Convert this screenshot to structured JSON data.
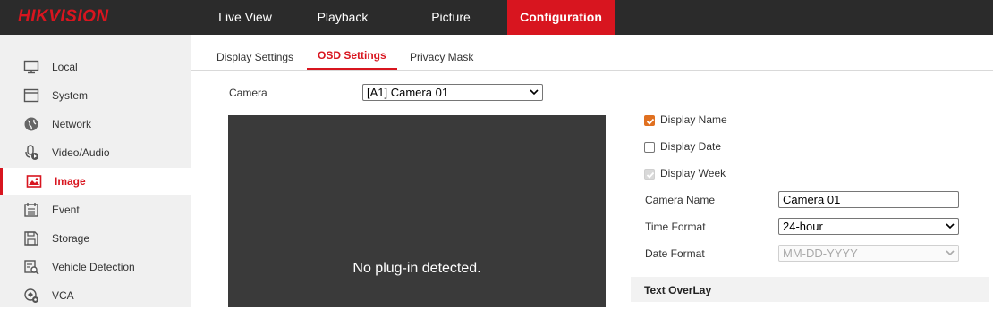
{
  "brand": "HIKVISION",
  "nav": {
    "tabs": [
      "Live View",
      "Playback",
      "Picture",
      "Configuration"
    ],
    "active": "Configuration"
  },
  "sidebar": {
    "items": [
      {
        "label": "Local",
        "icon": "monitor-icon"
      },
      {
        "label": "System",
        "icon": "system-window-icon"
      },
      {
        "label": "Network",
        "icon": "globe-icon"
      },
      {
        "label": "Video/Audio",
        "icon": "microphone-icon"
      },
      {
        "label": "Image",
        "icon": "image-icon"
      },
      {
        "label": "Event",
        "icon": "calendar-icon"
      },
      {
        "label": "Storage",
        "icon": "floppy-disk-icon"
      },
      {
        "label": "Vehicle Detection",
        "icon": "vehicle-search-icon"
      },
      {
        "label": "VCA",
        "icon": "vca-settings-icon"
      }
    ],
    "active": "Image"
  },
  "subtabs": {
    "items": [
      "Display Settings",
      "OSD Settings",
      "Privacy Mask"
    ],
    "active": "OSD Settings"
  },
  "form": {
    "camera_label": "Camera",
    "camera_value": "[A1] Camera 01",
    "display_name_label": "Display Name",
    "display_name_checked": true,
    "display_date_label": "Display Date",
    "display_date_checked": false,
    "display_week_label": "Display Week",
    "display_week_checked": true,
    "display_week_disabled": true,
    "camera_name_label": "Camera Name",
    "camera_name_value": "Camera 01",
    "time_format_label": "Time Format",
    "time_format_value": "24-hour",
    "date_format_label": "Date Format",
    "date_format_value": "MM-DD-YYYY",
    "date_format_disabled": true
  },
  "preview": {
    "message": "No plug-in detected."
  },
  "text_overlay": {
    "title": "Text OverLay"
  },
  "colors": {
    "accent": "#d8151f",
    "topbar": "#2b2b2b",
    "checkbox": "#e07020"
  }
}
